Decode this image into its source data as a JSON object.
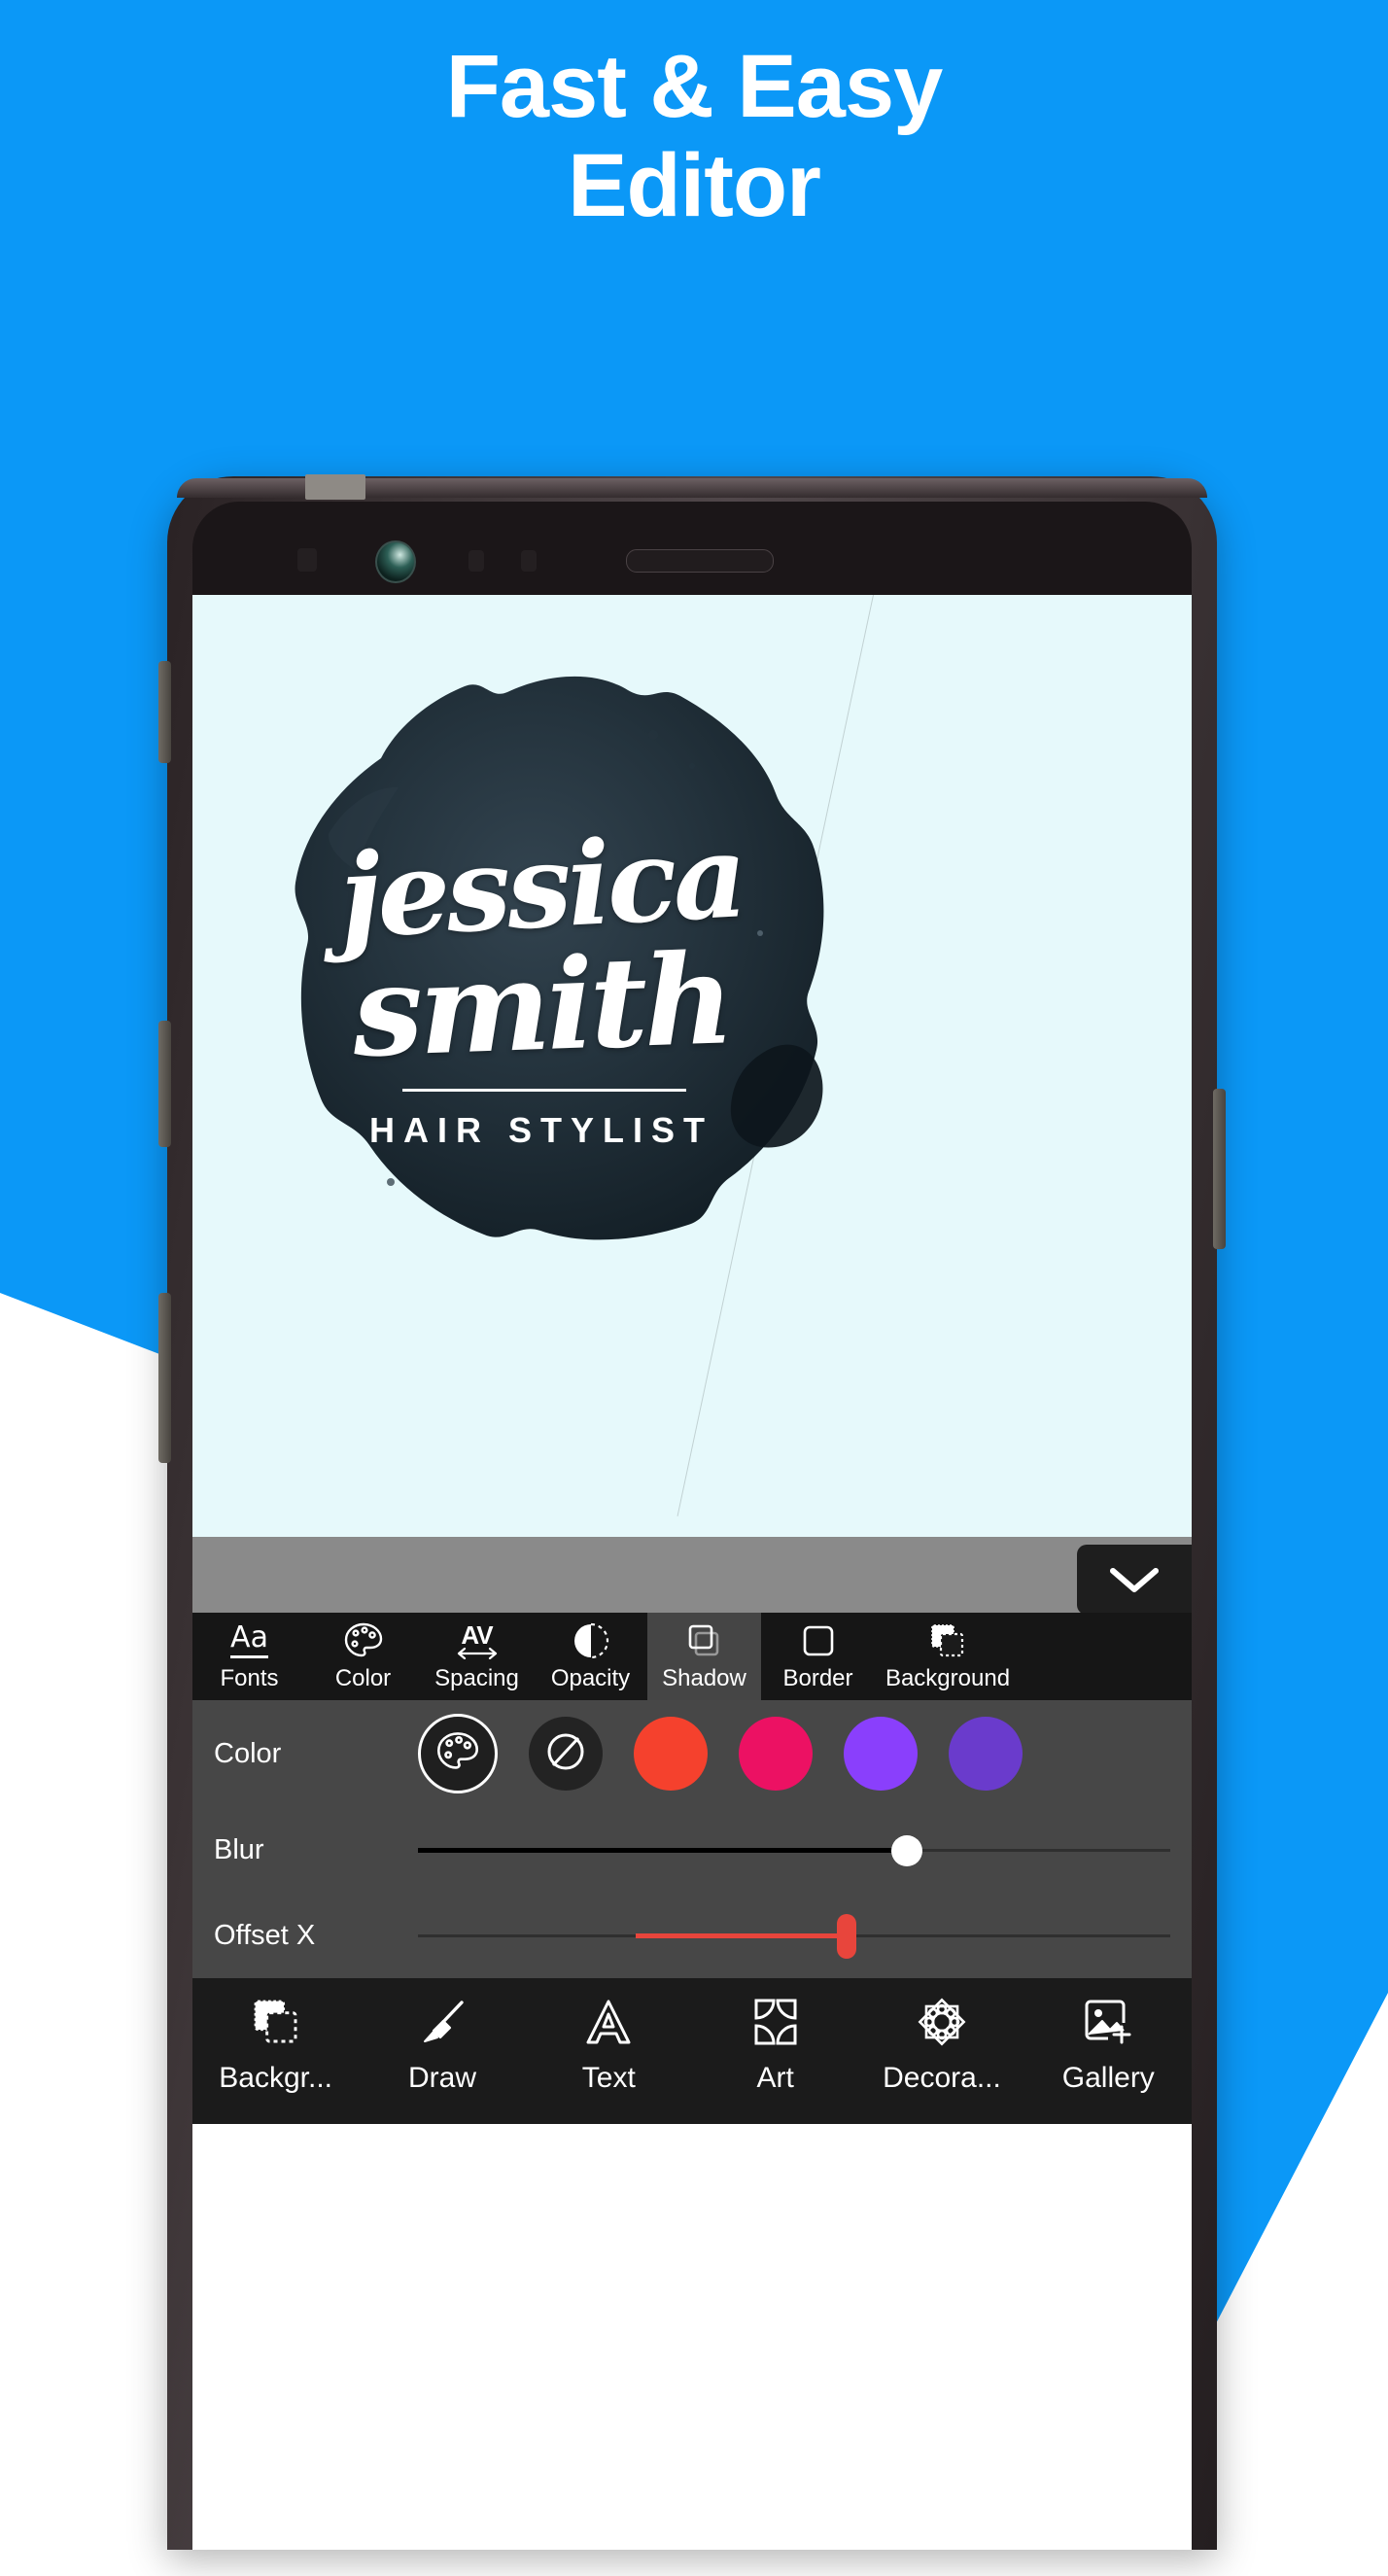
{
  "headline": {
    "line1": "Fast & Easy",
    "line2": "Editor"
  },
  "colors": {
    "brand_blue": "#0b98f7",
    "canvas_bg": "#e6f9fb",
    "panel_dark": "#161616",
    "panel_gray": "#474747",
    "strip_gray": "#8a8a8a",
    "nav_dark": "#1b1b1b",
    "accent_red": "#e8453c"
  },
  "canvas": {
    "logo_line1": "jessica",
    "logo_line2": "smith",
    "logo_subtitle": "HAIR STYLIST"
  },
  "collapse_button": {
    "icon": "chevron-down-icon"
  },
  "tabs": [
    {
      "id": "fonts",
      "label": "Fonts",
      "icon": "aa-underline-icon",
      "selected": false
    },
    {
      "id": "color",
      "label": "Color",
      "icon": "palette-icon",
      "selected": false
    },
    {
      "id": "spacing",
      "label": "Spacing",
      "icon": "av-arrows-icon",
      "selected": false
    },
    {
      "id": "opacity",
      "label": "Opacity",
      "icon": "half-circle-icon",
      "selected": false
    },
    {
      "id": "shadow",
      "label": "Shadow",
      "icon": "stacked-squares-icon",
      "selected": true
    },
    {
      "id": "border",
      "label": "Border",
      "icon": "square-outline-icon",
      "selected": false
    },
    {
      "id": "background",
      "label": "Background",
      "icon": "layers-dotted-icon",
      "selected": false
    }
  ],
  "color_row": {
    "label": "Color",
    "swatches": [
      {
        "name": "custom-color-picker",
        "kind": "picker",
        "color": "#1f1f1f"
      },
      {
        "name": "no-color",
        "kind": "none",
        "color": "#232323"
      },
      {
        "name": "swatch-red",
        "kind": "solid",
        "color": "#f5412d"
      },
      {
        "name": "swatch-pink",
        "kind": "solid",
        "color": "#ec1163"
      },
      {
        "name": "swatch-purple",
        "kind": "solid",
        "color": "#8a3ffc"
      },
      {
        "name": "swatch-violet",
        "kind": "solid",
        "color": "#6a3bcc"
      }
    ]
  },
  "sliders": [
    {
      "id": "blur",
      "label": "Blur",
      "percent": 65,
      "fill_color": "#000000",
      "thumb_color": "#ffffff",
      "thumb_shape": "round",
      "fill_from": "start"
    },
    {
      "id": "offsetx",
      "label": "Offset X",
      "percent": 57,
      "fill_color": "#e8453c",
      "thumb_color": "#e8453c",
      "thumb_shape": "bar",
      "fill_from": "14"
    }
  ],
  "bottom_nav": [
    {
      "id": "background",
      "label": "Backgr...",
      "icon": "layers-dotted-icon"
    },
    {
      "id": "draw",
      "label": "Draw",
      "icon": "paintbrush-icon"
    },
    {
      "id": "text",
      "label": "Text",
      "icon": "letter-a-icon"
    },
    {
      "id": "art",
      "label": "Art",
      "icon": "four-petals-icon"
    },
    {
      "id": "decoration",
      "label": "Decora...",
      "icon": "mandala-star-icon"
    },
    {
      "id": "gallery",
      "label": "Gallery",
      "icon": "image-plus-icon"
    }
  ]
}
